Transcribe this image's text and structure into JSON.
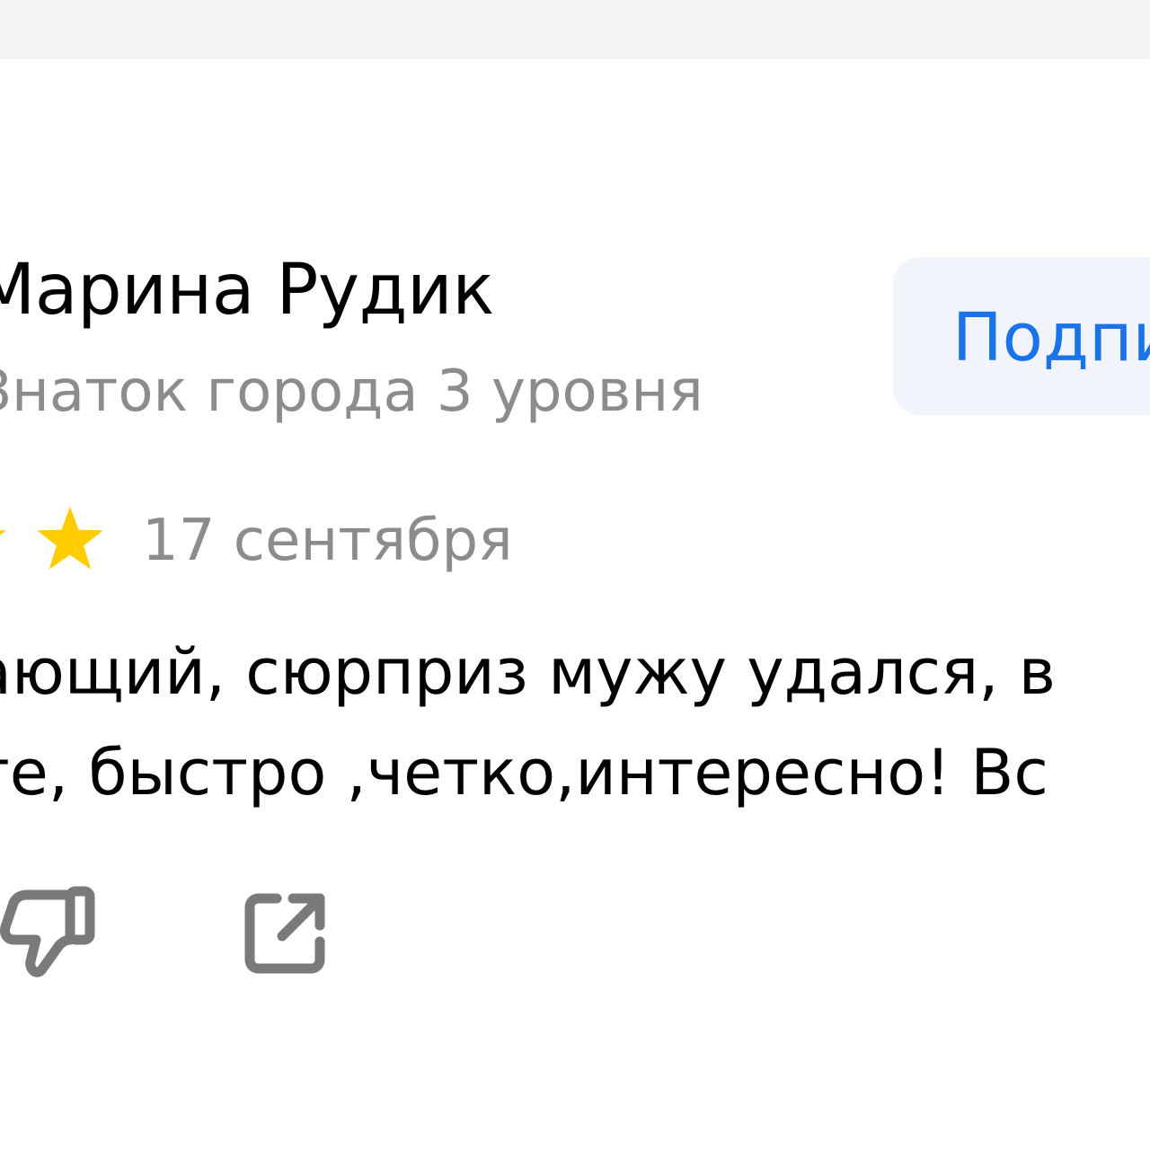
{
  "review": {
    "author_name": "Марина Рудик",
    "author_level": "Знаток города 3 уровня",
    "subscribe_label": "Подпи",
    "rating_visible_stars": 2,
    "date": "17 сентября",
    "text_line_1": "ающий, сюрприз мужу удался, в",
    "text_line_2": "те, быстро ,четко,интересно! Вс"
  },
  "actions": {
    "dislike_icon": "thumbs-down-icon",
    "share_icon": "share-external-icon"
  },
  "colors": {
    "star": "#ffcc00",
    "accent": "#1a73e8",
    "muted_text": "#8c8c8c",
    "button_bg": "#f1f4fb",
    "icon_gray": "#7a7a7a"
  }
}
